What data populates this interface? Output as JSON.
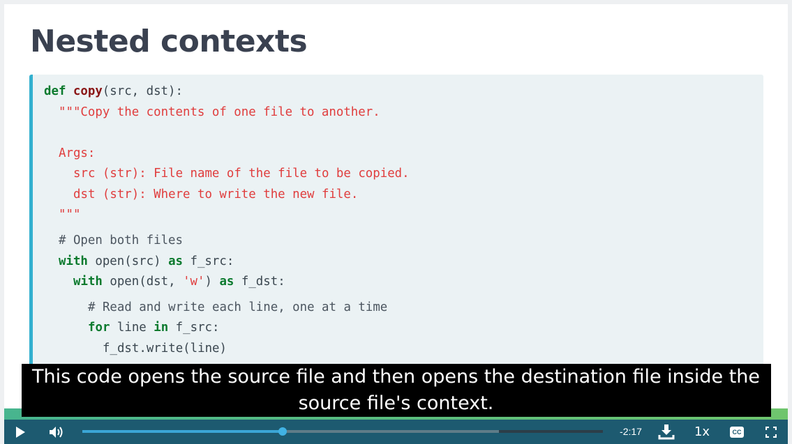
{
  "slide": {
    "title": "Nested contexts"
  },
  "code": {
    "l1": {
      "kw": "def",
      "fn": "copy",
      "rest": "(src, dst):"
    },
    "l2": "\"\"\"Copy the contents of one file to another.",
    "l3": "Args:",
    "l4": "src (str): File name of the file to be copied.",
    "l5": "dst (str): Where to write the new file.",
    "l6": "\"\"\"",
    "l7": "# Open both files",
    "l8": {
      "kw1": "with",
      "mid": " open(src) ",
      "kw2": "as",
      "rest": " f_src:"
    },
    "l9": {
      "kw1": "with",
      "mid": " open(dst, ",
      "str": "'w'",
      "mid2": ") ",
      "kw2": "as",
      "rest": " f_dst:"
    },
    "l10": "# Read and write each line, one at a time",
    "l11": {
      "kw1": "for",
      "mid": " line ",
      "kw2": "in",
      "rest": " f_src:"
    },
    "l12": "f_dst.write(line)"
  },
  "caption": {
    "text": "This code opens the source file and then opens the destination file inside the source file's context."
  },
  "player": {
    "time_remaining": "-2:17",
    "speed": "1x",
    "cc_label": "CC",
    "progress_fraction": 0.385,
    "buffered_fraction": 0.8,
    "icons": [
      "play-icon",
      "volume-icon",
      "download-icon",
      "closed-captions-icon",
      "fullscreen-icon"
    ],
    "colors": {
      "bar": "#1d5a70",
      "played": "#3aa6d6",
      "accent_strip": "#47b58f"
    }
  }
}
